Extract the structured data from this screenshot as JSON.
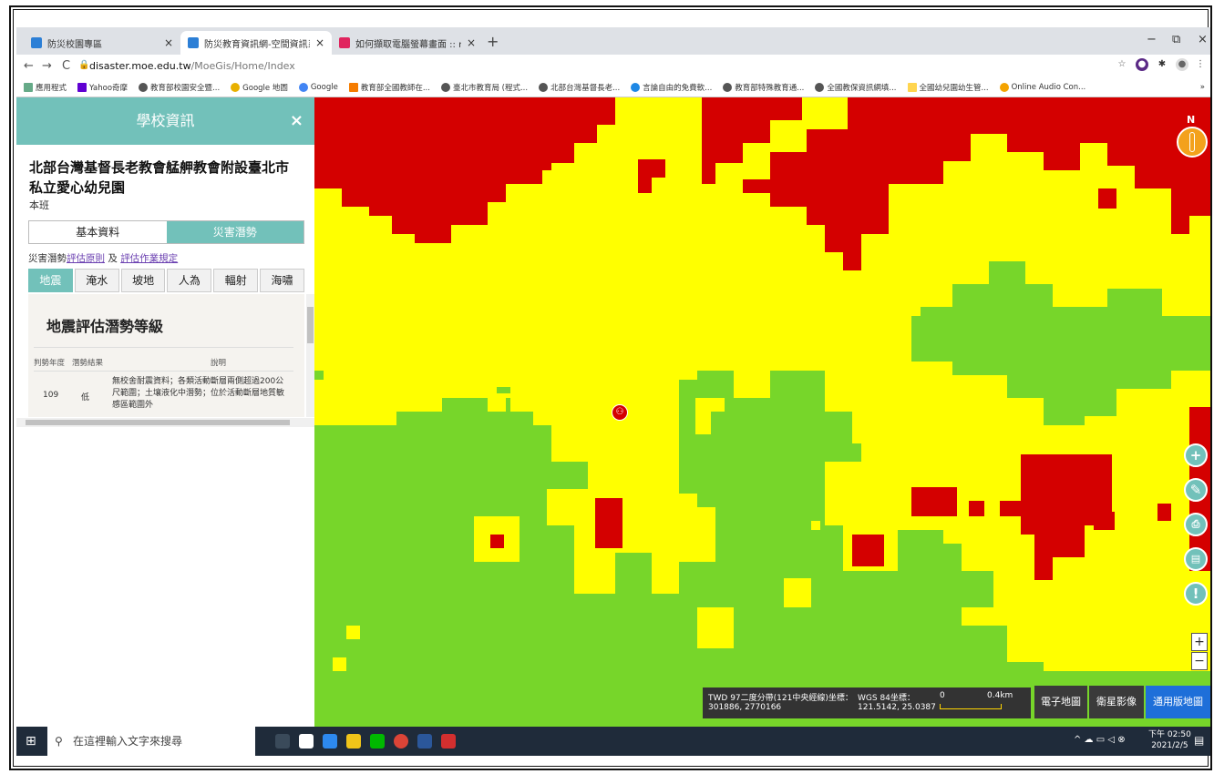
{
  "browser": {
    "tabs": [
      {
        "title": "防災校園專區",
        "close": "×"
      },
      {
        "title": "防災教育資訊網-空間資訊系統",
        "close": "×"
      },
      {
        "title": "如何擷取電腦螢幕畫面 :: nidBox",
        "close": "×"
      }
    ],
    "new_tab": "+",
    "window_controls": {
      "minimize": "−",
      "maximize": "⧉",
      "close": "×"
    },
    "url_host": "disaster.moe.edu.tw",
    "url_path": "/MoeGis/Home/Index",
    "bookmarks": [
      "應用程式",
      "Yahoo奇摩",
      "教育部校園安全暨...",
      "Google 地圖",
      "Google",
      "教育部全國教師在...",
      "臺北市教育局 (程式...",
      "北部台灣基督長老...",
      "言論自由的免費軟...",
      "教育部特殊教育通...",
      "全國教保資訊網填...",
      "全國幼兒園幼生管...",
      "Online Audio Con..."
    ],
    "bookmarks_more": "»"
  },
  "sidebar": {
    "title": "學校資訊",
    "close": "×",
    "school_name": "北部台灣基督長老教會艋舺教會附設臺北市私立愛心幼兒園",
    "class": "本班",
    "main_tabs": [
      "基本資料",
      "災害潛勢"
    ],
    "eval_prefix": "災害潛勢",
    "eval_link1": "評估原則",
    "eval_and": "及",
    "eval_link2": "評估作業規定",
    "hazard_tabs": [
      "地震",
      "淹水",
      "坡地",
      "人為",
      "輻射",
      "海嘯"
    ],
    "panel": {
      "heading": "地震評估潛勢等級",
      "col_year": "判勢年度",
      "col_result": "潛勢結果",
      "col_desc": "說明",
      "row": {
        "year": "109",
        "result": "低",
        "desc1": "無校舍耐震資料；各類活動斷層兩側超過200公",
        "desc2": "尺範圍；土壤液化中潛勢；位於活動斷層地質敏",
        "desc3": "感區範圍外"
      }
    }
  },
  "map": {
    "colors": {
      "high": "#d40000",
      "mid": "#ffff00",
      "low": "#77d62a",
      "accent": "#72c1ba"
    },
    "north_label": "N",
    "controls": [
      "plus-icon",
      "pen-icon",
      "print-icon",
      "measure-icon",
      "alert-icon"
    ],
    "zoom_in": "+",
    "zoom_out": "−",
    "twd_label": "TWD 97二度分帶(121中央經線)坐標：",
    "twd_value": "301886, 2770166",
    "wgs_label": "WGS 84坐標：",
    "wgs_value": "121.5142, 25.0387",
    "scale_start": "0",
    "scale_end": "0.4km",
    "basemaps": [
      "電子地圖",
      "衛星影像",
      "通用版地圖"
    ]
  },
  "taskbar": {
    "search_placeholder": "在這裡輸入文字來搜尋",
    "time": "下午 02:50",
    "date": "2021/2/5"
  }
}
